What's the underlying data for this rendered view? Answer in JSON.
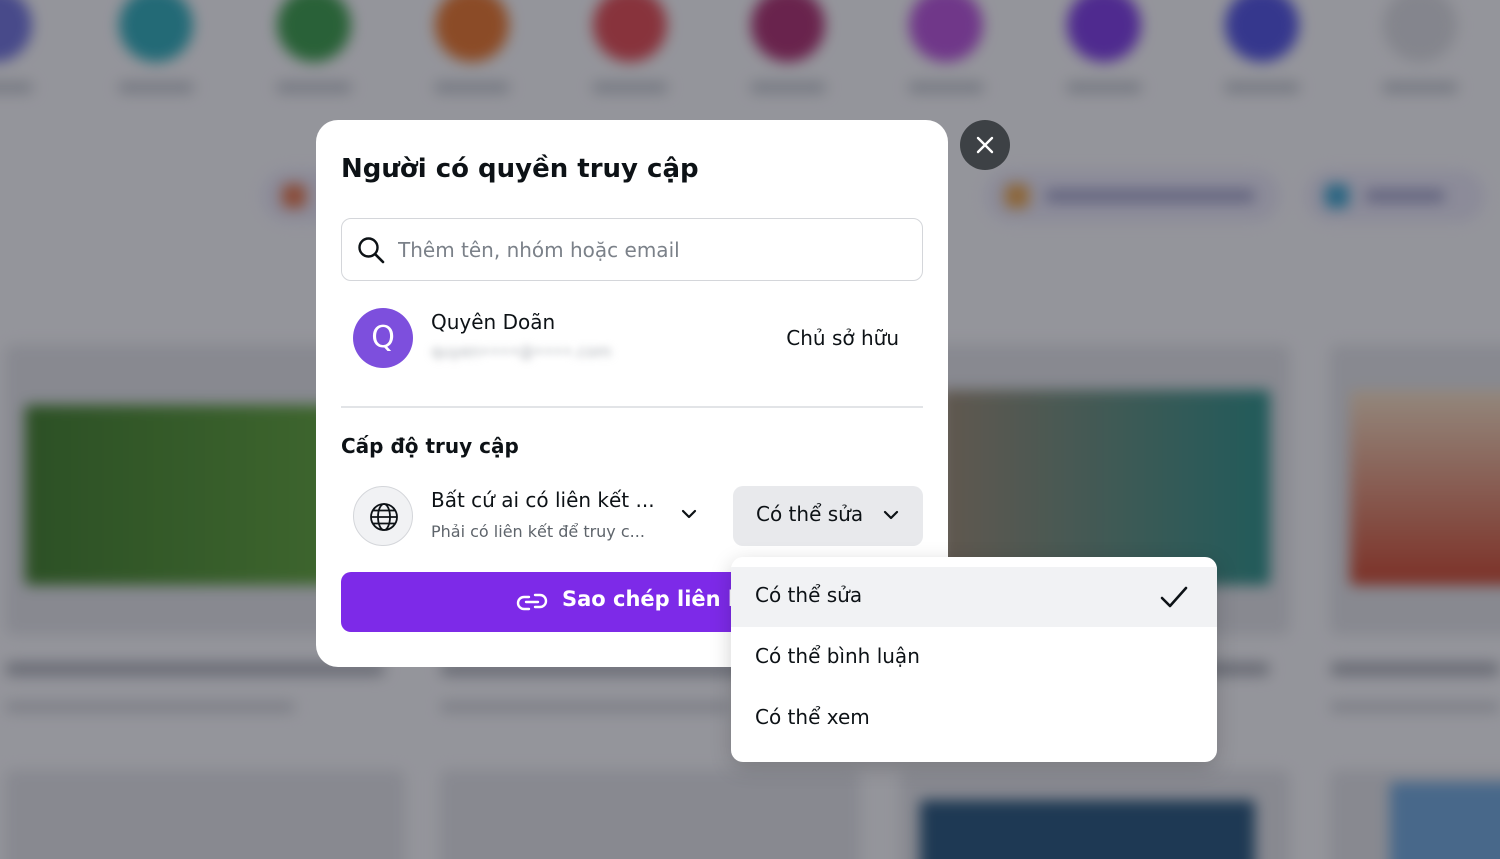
{
  "modal": {
    "title": "Người có quyền truy cập",
    "search_placeholder": "Thêm tên, nhóm hoặc email",
    "owner": {
      "avatar_letter": "Q",
      "name": "Quyên Doãn",
      "email": "quyen••••@••••.com",
      "role": "Chủ sở hữu"
    },
    "access_section_label": "Cấp độ truy cập",
    "link_access": {
      "title": "Bất cứ ai có liên kết ...",
      "description": "Phải có liên kết để truy c..."
    },
    "permission_selected": "Có thể sửa",
    "copy_link_label": "Sao chép liên kết"
  },
  "dropdown": {
    "options": [
      "Có thể sửa",
      "Có thể bình luận",
      "Có thể xem"
    ],
    "selected_index": 0
  },
  "icons": {
    "search": "search-icon",
    "globe": "globe-icon",
    "chevron": "chevron-down-icon",
    "link": "link-icon",
    "close": "close-icon",
    "check": "check-icon"
  },
  "colors": {
    "primary_purple": "#7d2ae8",
    "avatar_purple": "#7d4fdd",
    "close_button": "#3d4145",
    "selected_bg": "#f1f2f4"
  }
}
